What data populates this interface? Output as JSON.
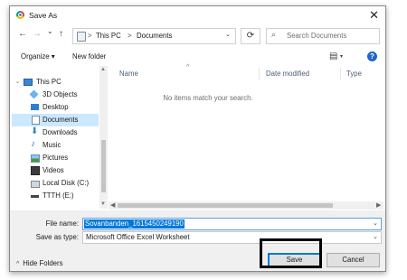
{
  "window": {
    "title": "Save As",
    "app_icon": "chrome-icon",
    "close_glyph": "✕"
  },
  "nav": {
    "back": "←",
    "forward": "→",
    "recent": "⌄",
    "up": "↑",
    "breadcrumb": [
      "This PC",
      "Documents"
    ],
    "separator": ">",
    "refresh": "⟳",
    "search_placeholder": "Search Documents",
    "search_icon": "⌕"
  },
  "toolbar": {
    "organize": "Organize ▾",
    "new_folder": "New folder",
    "view_glyph": "▤",
    "view_caret": "▾",
    "help": "?"
  },
  "sidebar": {
    "items": [
      {
        "label": "This PC",
        "icon": "pc-icon",
        "selected": false
      },
      {
        "label": "3D Objects",
        "icon": "3d-objects-icon",
        "selected": false
      },
      {
        "label": "Desktop",
        "icon": "desktop-icon",
        "selected": false
      },
      {
        "label": "Documents",
        "icon": "documents-icon",
        "selected": true
      },
      {
        "label": "Downloads",
        "icon": "downloads-icon",
        "selected": false
      },
      {
        "label": "Music",
        "icon": "music-icon",
        "selected": false
      },
      {
        "label": "Pictures",
        "icon": "pictures-icon",
        "selected": false
      },
      {
        "label": "Videos",
        "icon": "videos-icon",
        "selected": false
      },
      {
        "label": "Local Disk (C:)",
        "icon": "local-disk-icon",
        "selected": false
      },
      {
        "label": "TTTH (E:)",
        "icon": "drive-icon",
        "selected": false
      }
    ]
  },
  "content": {
    "columns": [
      "Name",
      "Date modified",
      "Type"
    ],
    "empty_message": "No items match your search."
  },
  "form": {
    "file_name_label": "File name:",
    "file_name_value": "Sovanbanden_1615450249190",
    "save_type_label": "Save as type:",
    "save_type_value": "Microsoft Office Excel Worksheet",
    "hide_folders": "Hide Folders",
    "save": "Save",
    "cancel": "Cancel"
  },
  "colors": {
    "accent": "#0078d7",
    "selected_bg": "#cce8ff",
    "help_blue": "#1e66c8",
    "highlight_box": "#000000"
  }
}
